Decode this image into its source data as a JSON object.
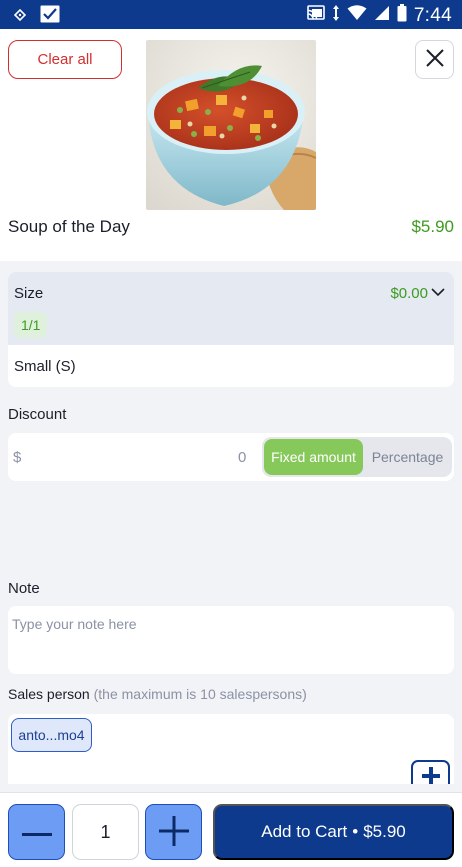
{
  "status_bar": {
    "time": "7:44",
    "colors": {
      "background": "#0d3a8c"
    }
  },
  "header": {
    "clear_label": "Clear all",
    "product_name": "Soup of the Day",
    "product_price": "$5.90"
  },
  "size": {
    "title": "Size",
    "price": "$0.00",
    "badge": "1/1",
    "option": "Small (S)"
  },
  "discount": {
    "label": "Discount",
    "currency": "$",
    "value": "0",
    "fixed_label": "Fixed amount",
    "percent_label": "Percentage",
    "selected": "Fixed amount"
  },
  "note": {
    "label": "Note",
    "placeholder": "Type your note here"
  },
  "sales": {
    "label": "Sales person",
    "hint": "(the maximum is 10 salespersons)",
    "chip": "anto...mo4"
  },
  "cart": {
    "quantity": "1",
    "add_label": "Add to Cart",
    "separator": "•",
    "total": "$5.90"
  },
  "colors": {
    "primary": "#0d3a8c",
    "accent_blue": "#6c9cf4",
    "green": "#3d9b1f",
    "toggle_green": "#86c95a",
    "danger": "#d32f2f"
  }
}
